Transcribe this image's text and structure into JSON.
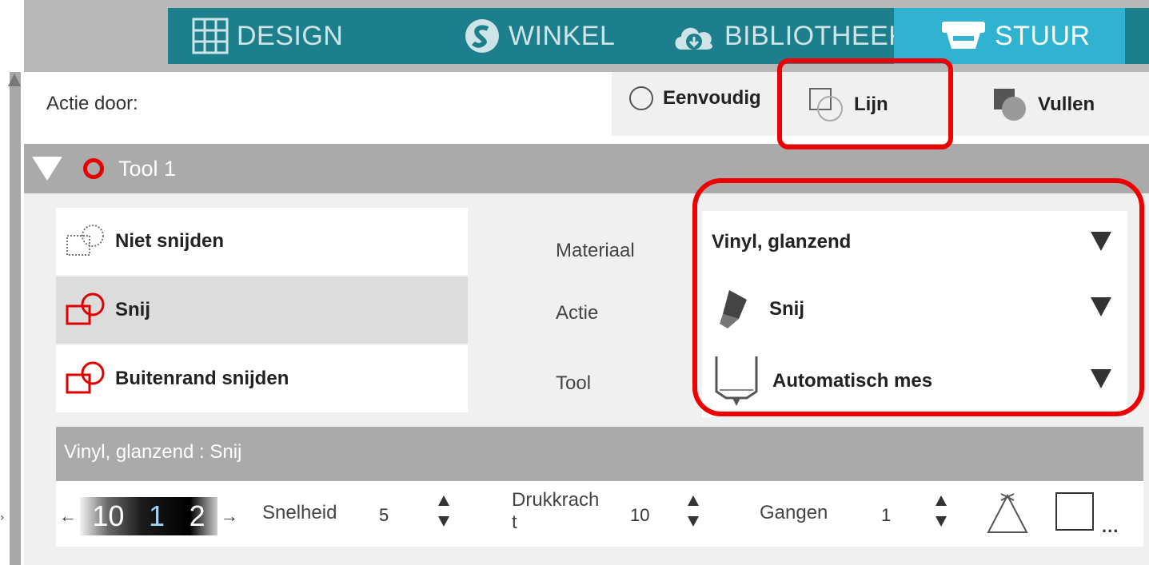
{
  "nav": {
    "tabs": [
      {
        "label": "DESIGN",
        "icon": "grid-icon"
      },
      {
        "label": "WINKEL",
        "icon": "store-s-icon"
      },
      {
        "label": "BIBLIOTHEEK",
        "icon": "cloud-download-icon"
      },
      {
        "label": "STUUR",
        "icon": "cutter-icon",
        "active": true
      }
    ]
  },
  "action_row": {
    "label": "Actie door:",
    "modes": [
      {
        "label": "Eenvoudig",
        "icon": "radio-circle-icon"
      },
      {
        "label": "Lijn",
        "icon": "line-mode-icon",
        "highlighted": true
      },
      {
        "label": "Vullen",
        "icon": "fill-mode-icon"
      }
    ]
  },
  "tool_header": {
    "label": "Tool 1"
  },
  "cut_options": [
    {
      "label": "Niet snijden",
      "icon": "no-cut-icon"
    },
    {
      "label": "Snij",
      "icon": "cut-icon",
      "selected": true
    },
    {
      "label": "Buitenrand snijden",
      "icon": "cut-outline-icon"
    }
  ],
  "fields": {
    "material": {
      "label": "Materiaal",
      "value": "Vinyl, glanzend"
    },
    "action": {
      "label": "Actie",
      "value": "Snij"
    },
    "tool": {
      "label": "Tool",
      "value": "Automatisch mes"
    }
  },
  "summary": {
    "text": "Vinyl, glanzend : Snij"
  },
  "blade_strip": {
    "digits": [
      "10",
      "1",
      "2"
    ]
  },
  "params": {
    "speed": {
      "label": "Snelheid",
      "value": "5"
    },
    "force": {
      "label": "Drukkrach\nt",
      "value": "10"
    },
    "passes": {
      "label": "Gangen",
      "value": "1"
    }
  },
  "more_label": "...",
  "colors": {
    "nav_teal": "#1e7f8c",
    "nav_active": "#2fb3d0",
    "highlight_red": "#ee0000",
    "header_gray": "#aaaaaa"
  }
}
